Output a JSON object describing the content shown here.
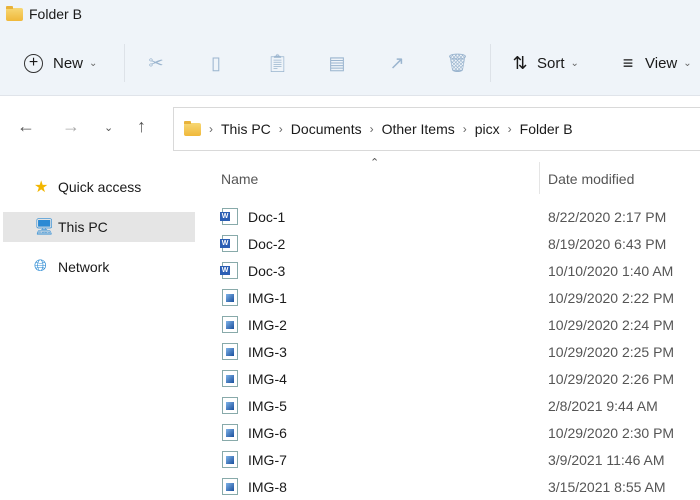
{
  "window": {
    "title": "Folder B"
  },
  "toolbar": {
    "new_label": "New",
    "sort_label": "Sort",
    "view_label": "View"
  },
  "address": {
    "crumbs": [
      "This PC",
      "Documents",
      "Other Items",
      "picx",
      "Folder B"
    ]
  },
  "sidebar": {
    "items": [
      {
        "label": "Quick access"
      },
      {
        "label": "This PC",
        "selected": true
      },
      {
        "label": "Network"
      }
    ]
  },
  "columns": {
    "name": "Name",
    "date": "Date modified"
  },
  "files": [
    {
      "name": "Doc-1",
      "date": "8/22/2020 2:17 PM",
      "type": "word"
    },
    {
      "name": "Doc-2",
      "date": "8/19/2020 6:43 PM",
      "type": "word"
    },
    {
      "name": "Doc-3",
      "date": "10/10/2020 1:40 AM",
      "type": "word"
    },
    {
      "name": "IMG-1",
      "date": "10/29/2020 2:22 PM",
      "type": "image"
    },
    {
      "name": "IMG-2",
      "date": "10/29/2020 2:24 PM",
      "type": "image"
    },
    {
      "name": "IMG-3",
      "date": "10/29/2020 2:25 PM",
      "type": "image"
    },
    {
      "name": "IMG-4",
      "date": "10/29/2020 2:26 PM",
      "type": "image"
    },
    {
      "name": "IMG-5",
      "date": "2/8/2021 9:44 AM",
      "type": "image"
    },
    {
      "name": "IMG-6",
      "date": "10/29/2020 2:30 PM",
      "type": "image"
    },
    {
      "name": "IMG-7",
      "date": "3/9/2021 11:46 AM",
      "type": "image"
    },
    {
      "name": "IMG-8",
      "date": "3/15/2021 8:55 AM",
      "type": "image"
    }
  ]
}
